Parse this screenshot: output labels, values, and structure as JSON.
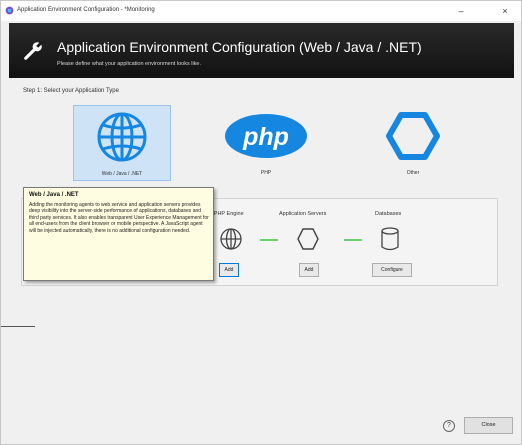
{
  "window": {
    "title": "Application Environment Configuration - *Monitoring",
    "minimize_glyph": "–",
    "close_glyph": "×"
  },
  "header": {
    "title": "Application Environment Configuration (Web / Java / .NET)",
    "subtitle": "Please define what your application environment looks like.",
    "icon": "wrench-icon"
  },
  "step1": {
    "label": "Step 1: Select your Application Type",
    "types": [
      {
        "label": "Web / Java / .NET",
        "icon": "globe-icon",
        "selected": true
      },
      {
        "label": "PHP",
        "icon": "php-logo-icon",
        "selected": false
      },
      {
        "label": "Other",
        "icon": "hexagon-icon",
        "selected": false
      }
    ]
  },
  "step2": {
    "label": "S",
    "stages": [
      {
        "label": "Web / PHP Engine",
        "button": "Add"
      },
      {
        "label": "Application Servers",
        "button": "Add"
      },
      {
        "label": "Databases",
        "button": "Configure"
      }
    ]
  },
  "tooltip": {
    "title": "Web / Java / .NET",
    "body": "Adding the monitoring agents to web service and application servers provides deep visibility into the server-side performance of applications, databases and third party services. It also enables transparent User Experience Management for all end-users from the client browser or mobile perspective. A JavaScript agent will be injected automatically, there is no additional configuration needed."
  },
  "footer": {
    "help_glyph": "?",
    "close_label": "Close"
  },
  "colors": {
    "header_bg": "#1a1a1a",
    "accent_blue": "#1687e0",
    "connector_green": "#6ad36a",
    "selected_tile": "#cfe3f7",
    "tooltip_bg": "#fffde1"
  }
}
